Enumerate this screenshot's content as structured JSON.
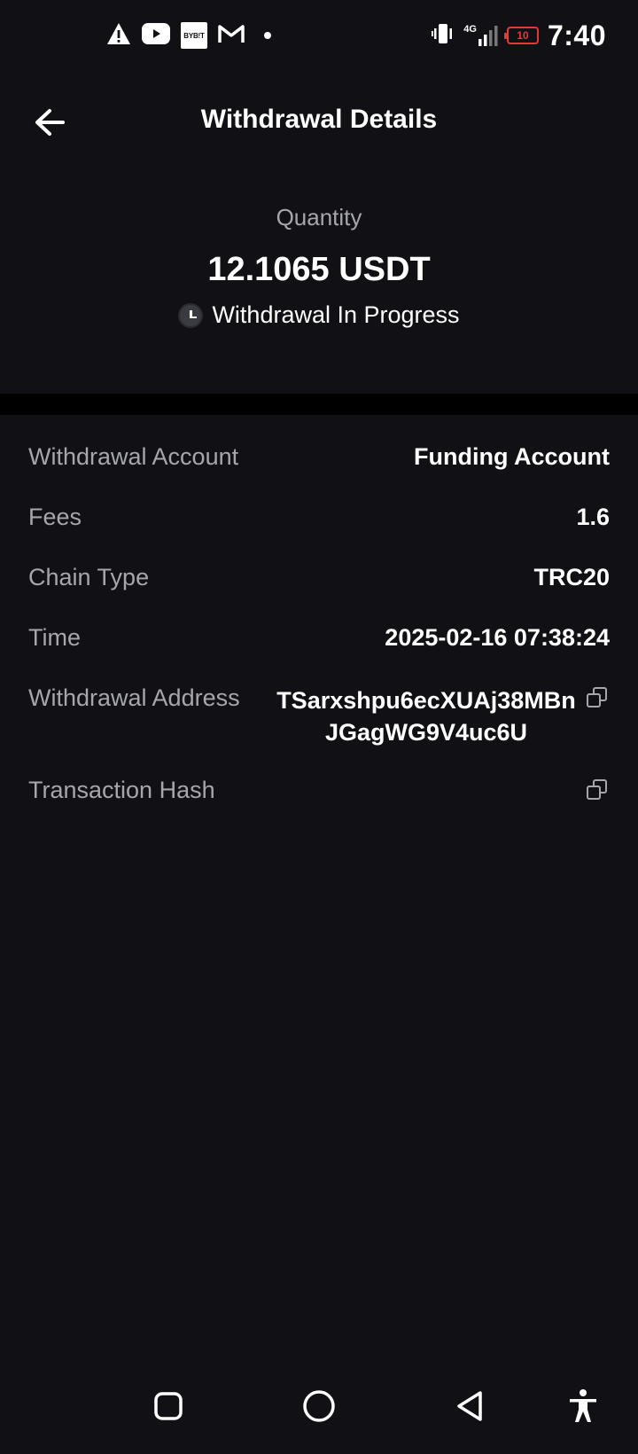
{
  "status_bar": {
    "time": "7:40",
    "battery_level": "10",
    "network_type": "4G",
    "bybit_label": "BYB!T",
    "left_icons": [
      "warning-icon",
      "youtube-icon",
      "bybit-icon",
      "gmail-icon",
      "dot-icon"
    ],
    "right_icons": [
      "vibrate-icon",
      "signal-icon",
      "battery-icon"
    ]
  },
  "header": {
    "title": "Withdrawal Details",
    "back_icon": "arrow-left-icon"
  },
  "summary": {
    "quantity_label": "Quantity",
    "quantity_value": "12.1065 USDT",
    "status_text": "Withdrawal In Progress",
    "status_icon": "clock-icon"
  },
  "details": {
    "withdrawal_account": {
      "label": "Withdrawal Account",
      "value": "Funding Account"
    },
    "fees": {
      "label": "Fees",
      "value": "1.6"
    },
    "chain_type": {
      "label": "Chain Type",
      "value": "TRC20"
    },
    "time": {
      "label": "Time",
      "value": "2025-02-16 07:38:24"
    },
    "withdrawal_address": {
      "label": "Withdrawal Address",
      "value": "TSarxshpu6ecXUAj38MBnJGagWG9V4uc6U"
    },
    "transaction_hash": {
      "label": "Transaction Hash",
      "value": ""
    }
  },
  "nav_bar": {
    "icons": [
      "recents-icon",
      "home-icon",
      "back-icon",
      "accessibility-icon"
    ]
  },
  "colors": {
    "background": "#111115",
    "divider": "#000000",
    "label_gray": "#a5a7ad",
    "text_white": "#ffffff",
    "battery_red": "#e53935"
  }
}
